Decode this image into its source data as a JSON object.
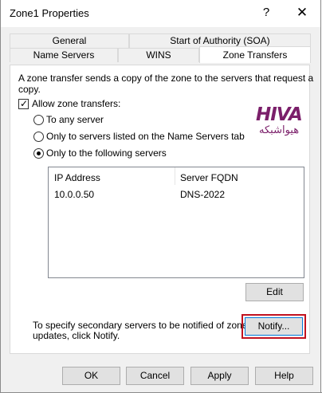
{
  "window": {
    "title": "Zone1 Properties",
    "help_label": "?",
    "close_label": "✕"
  },
  "tabs_row1": [
    {
      "label": "General"
    },
    {
      "label": "Start of Authority (SOA)"
    }
  ],
  "tabs_row2": [
    {
      "label": "Name Servers"
    },
    {
      "label": "WINS"
    },
    {
      "label": "Zone Transfers",
      "active": true
    }
  ],
  "zone_transfers": {
    "description": [
      "A zone transfer sends a copy of the zone to the servers that request a",
      "copy."
    ],
    "allow_label": "Allow zone transfers:",
    "allow_checked": true,
    "options": [
      {
        "label": "To any server",
        "selected": false
      },
      {
        "label": "Only to servers listed on the Name Servers tab",
        "selected": false
      },
      {
        "label": "Only to the following servers",
        "selected": true
      }
    ],
    "table": {
      "columns": [
        "IP Address",
        "Server FQDN"
      ],
      "rows": [
        {
          "ip": "10.0.0.50",
          "fqdn": "DNS-2022"
        }
      ]
    },
    "edit_label": "Edit",
    "notify_text": [
      "To specify secondary servers to be notified of zone",
      "updates, click Notify."
    ],
    "notify_label": "Notify..."
  },
  "logo": {
    "mark": "HIVA",
    "subtitle": "هیواشبکه",
    "color": "#7b1f6a"
  },
  "footer": {
    "ok_label": "OK",
    "cancel_label": "Cancel",
    "apply_label": "Apply",
    "help_label": "Help"
  },
  "colors": {
    "highlight": "#c1121f",
    "focus": "#0078d7"
  }
}
